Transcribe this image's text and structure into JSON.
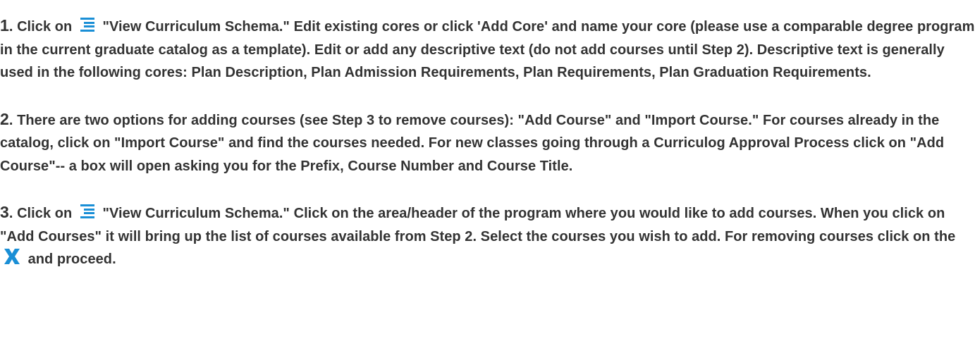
{
  "steps": [
    {
      "number": "1",
      "number_suffix": ". ",
      "segments": [
        {
          "type": "text",
          "value": "Click on "
        },
        {
          "type": "icon",
          "name": "list-icon"
        },
        {
          "type": "text",
          "value": " \"View Curriculum Schema.\" Edit existing cores or click 'Add Core' and name your core (please use a comparable degree program in the current graduate catalog as a template). Edit or add any descriptive text (do not add courses until Step 2). Descriptive text is generally used in the following cores: Plan Description, Plan Admission Requirements, Plan Requirements, Plan Graduation Requirements."
        }
      ]
    },
    {
      "number": "2",
      "number_suffix": ". ",
      "segments": [
        {
          "type": "text",
          "value": "There are two options for adding courses (see Step 3 to remove courses): \"Add Course\" and \"Import Course.\" For courses already in the catalog, click on \"Import Course\" and find the courses needed. For new classes going through a Curriculog Approval Process click on \"Add Course\"-- a box will open asking you for the Prefix, Course Number and Course Title."
        }
      ]
    },
    {
      "number": "3",
      "number_suffix": ". ",
      "segments": [
        {
          "type": "text",
          "value": "Click on "
        },
        {
          "type": "icon",
          "name": "list-icon"
        },
        {
          "type": "text",
          "value": " \"View Curriculum Schema.\" Click on the area/header of the program where you would like to add courses. When you click on \"Add Courses\" it will bring up the list of courses available from Step 2. Select the courses you wish to add. For removing courses click on the "
        },
        {
          "type": "icon",
          "name": "x-icon"
        },
        {
          "type": "text",
          "value": " and proceed."
        }
      ]
    }
  ],
  "colors": {
    "text": "#333333",
    "icon_blue": "#1a8fd6"
  }
}
